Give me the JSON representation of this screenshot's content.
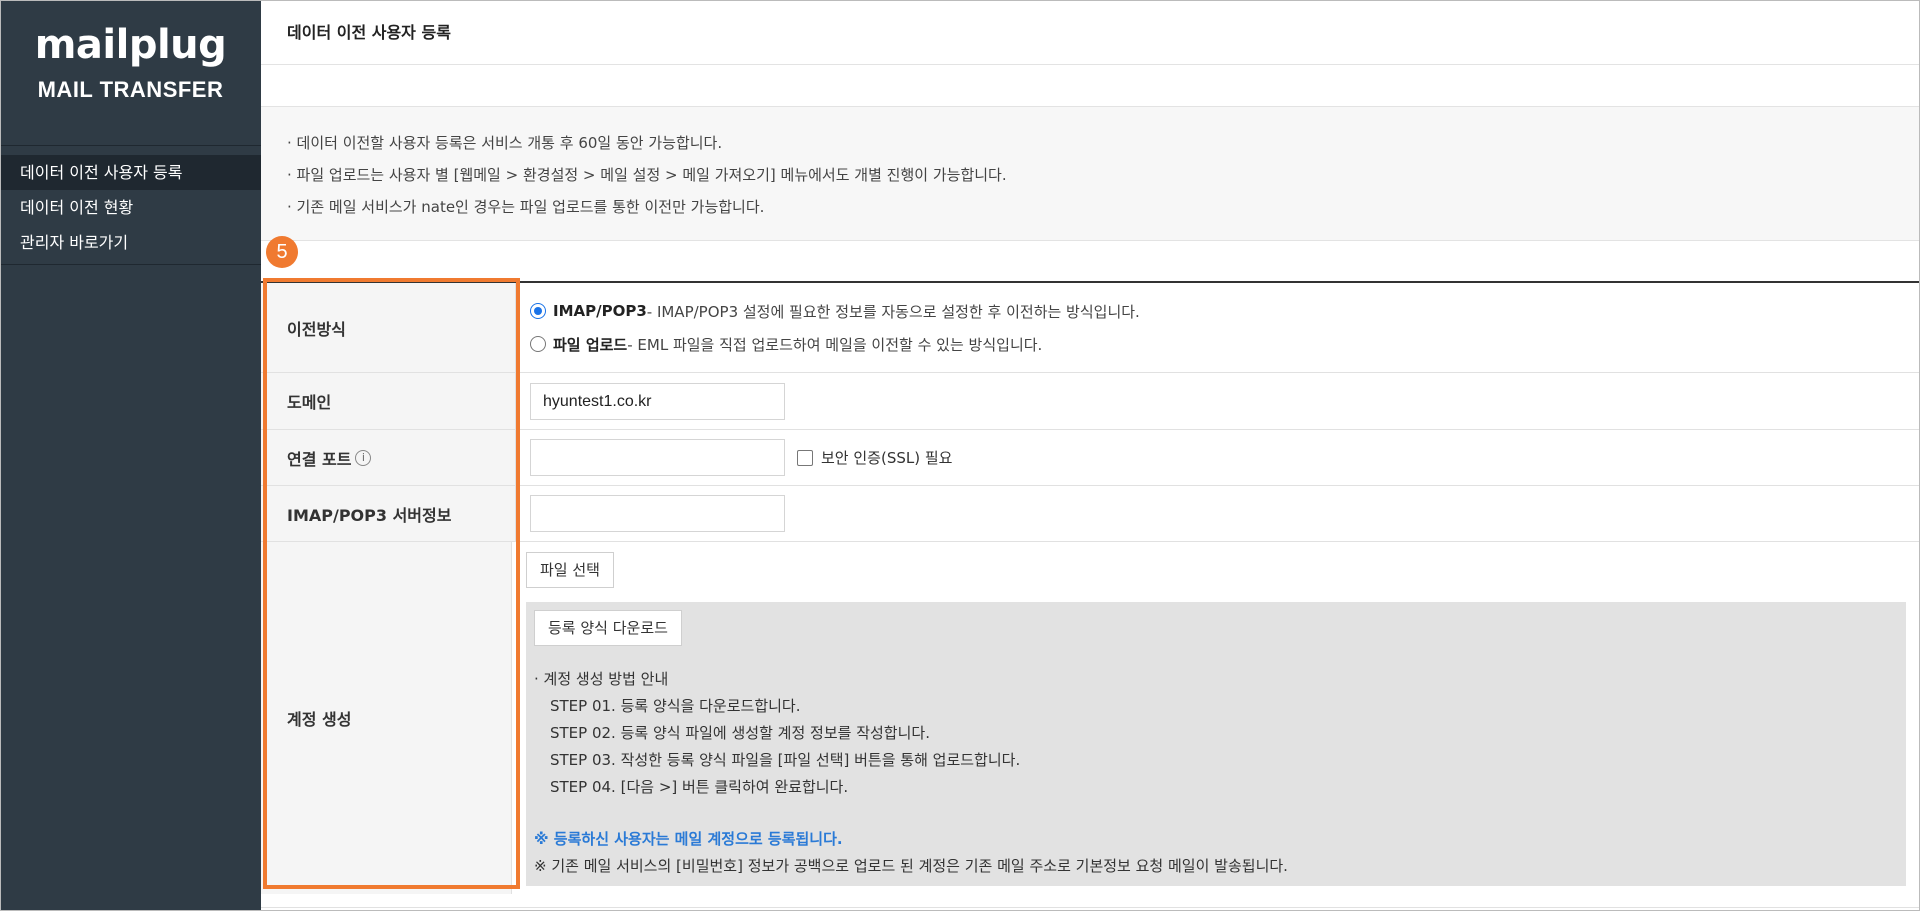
{
  "brand": {
    "logo": "mailplug",
    "subtitle": "MAIL TRANSFER"
  },
  "sidebar": {
    "items": [
      {
        "label": "데이터 이전 사용자 등록",
        "active": true
      },
      {
        "label": "데이터 이전 현황",
        "active": false
      },
      {
        "label": "관리자 바로가기",
        "active": false
      }
    ]
  },
  "header": {
    "title": "데이터 이전 사용자 등록"
  },
  "notice": {
    "lines": [
      "· 데이터 이전할 사용자 등록은 서비스 개통 후 60일 동안 가능합니다.",
      "· 파일 업로드는 사용자 별 [웹메일 > 환경설정 > 메일 설정 > 메일 가져오기] 메뉴에서도 개별 진행이 가능합니다.",
      "· 기존 메일 서비스가 nate인 경우는 파일 업로드를 통한 이전만 가능합니다."
    ]
  },
  "badge": "5",
  "form": {
    "method": {
      "label": "이전방식",
      "options": [
        {
          "name": "IMAP/POP3",
          "desc": " - IMAP/POP3 설정에 필요한 정보를 자동으로 설정한 후 이전하는 방식입니다.",
          "checked": true
        },
        {
          "name": "파일 업로드",
          "desc": " - EML 파일을 직접 업로드하여 메일을 이전할 수 있는 방식입니다.",
          "checked": false
        }
      ]
    },
    "domain": {
      "label": "도메인",
      "value": "hyuntest1.co.kr"
    },
    "port": {
      "label": "연결 포트",
      "info_icon": "i",
      "value": "",
      "ssl_label": "보안 인증(SSL) 필요"
    },
    "server": {
      "label": "IMAP/POP3 서버정보",
      "value": ""
    },
    "account": {
      "label": "계정 생성",
      "file_button": "파일 선택",
      "download_button": "등록 양식 다운로드",
      "guide_title": "· 계정 생성 방법 안내",
      "steps": [
        "STEP 01. 등록 양식을 다운로드합니다.",
        "STEP 02. 등록 양식 파일에 생성할 계정 정보를 작성합니다.",
        "STEP 03. 작성한 등록 양식 파일을 [파일 선택] 버튼을 통해 업로드합니다.",
        "STEP 04. [다음 >] 버튼 클릭하여 완료합니다."
      ],
      "note_blue": "※ 등록하신 사용자는 메일 계정으로 등록됩니다.",
      "note": "※ 기존 메일 서비스의 [비밀번호] 정보가 공백으로 업로드 된 계정은 기존 메일 주소로 기본정보 요청 메일이 발송됩니다."
    }
  },
  "colors": {
    "sidebar_bg": "#2f3b45",
    "highlight": "#f07a30",
    "accent_blue": "#2a7ad6"
  }
}
